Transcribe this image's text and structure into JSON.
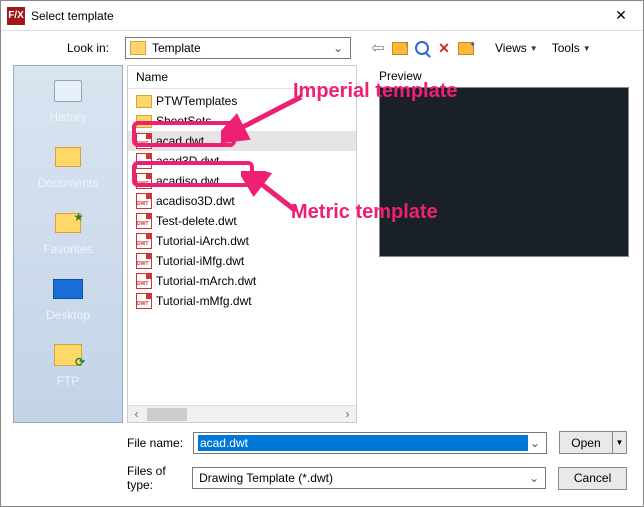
{
  "window": {
    "title": "Select template",
    "app_badge": "F/X"
  },
  "lookin": {
    "label": "Look in:",
    "value": "Template"
  },
  "toolbar_menu": {
    "views": "Views",
    "tools": "Tools"
  },
  "sidebar": {
    "items": [
      {
        "label": "History"
      },
      {
        "label": "Documents"
      },
      {
        "label": "Favorites"
      },
      {
        "label": "Desktop"
      },
      {
        "label": "FTP"
      }
    ]
  },
  "list": {
    "header": "Name",
    "rows": [
      {
        "kind": "folder",
        "name": "PTWTemplates"
      },
      {
        "kind": "folder",
        "name": "SheetSets"
      },
      {
        "kind": "dwt",
        "name": "acad.dwt",
        "selected": true
      },
      {
        "kind": "dwt",
        "name": "acad3D.dwt"
      },
      {
        "kind": "dwt",
        "name": "acadiso.dwt"
      },
      {
        "kind": "dwt",
        "name": "acadiso3D.dwt"
      },
      {
        "kind": "dwt",
        "name": "Test-delete.dwt"
      },
      {
        "kind": "dwt",
        "name": "Tutorial-iArch.dwt"
      },
      {
        "kind": "dwt",
        "name": "Tutorial-iMfg.dwt"
      },
      {
        "kind": "dwt",
        "name": "Tutorial-mArch.dwt"
      },
      {
        "kind": "dwt",
        "name": "Tutorial-mMfg.dwt"
      }
    ]
  },
  "preview": {
    "label": "Preview"
  },
  "filename": {
    "label": "File name:",
    "value": "acad.dwt"
  },
  "filetype": {
    "label": "Files of type:",
    "value": "Drawing Template (*.dwt)"
  },
  "buttons": {
    "open": "Open",
    "cancel": "Cancel"
  },
  "annotations": {
    "imperial": "Imperial template",
    "metric": "Metric template"
  }
}
